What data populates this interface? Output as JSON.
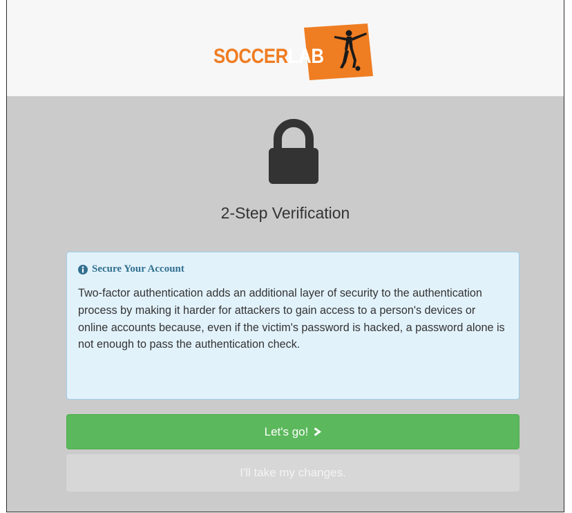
{
  "brand": {
    "logo_part1": "SOCCER",
    "logo_part2": "LAB",
    "logo_orange": "#ef7d22"
  },
  "page": {
    "icon": "lock-icon",
    "title": "2-Step Verification"
  },
  "alert": {
    "icon": "info-circle-icon",
    "heading": "Secure Your Account",
    "body": "Two-factor authentication adds an additional layer of security to the authentication process by making it harder for attackers to gain access to a person's devices or online accounts because, even if the victim's password is hacked, a password alone is not enough to pass the authentication check."
  },
  "actions": {
    "primary_label": "Let's go!",
    "primary_icon": "chevron-right-icon",
    "primary_color": "#5cb85c",
    "secondary_label": "I'll take my changes."
  }
}
